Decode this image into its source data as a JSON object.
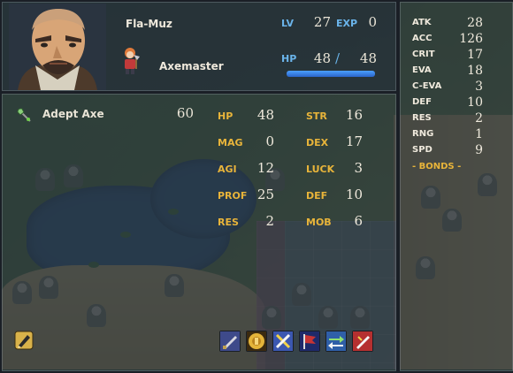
{
  "unit": {
    "name": "Fla-Muz",
    "class": "Axemaster",
    "level_label": "LV",
    "level": "27",
    "exp_label": "EXP",
    "exp": "0",
    "hp_label": "HP",
    "hp_current": "48",
    "hp_separator": "/",
    "hp_max": "48",
    "hp_fill_fraction": 1.0
  },
  "weapon": {
    "icon": "axe-icon",
    "name": "Adept Axe",
    "uses": "60"
  },
  "stats": [
    {
      "label": "HP",
      "value": "48"
    },
    {
      "label": "STR",
      "value": "16"
    },
    {
      "label": "MAG",
      "value": "0"
    },
    {
      "label": "DEX",
      "value": "17"
    },
    {
      "label": "AGI",
      "value": "12"
    },
    {
      "label": "LUCK",
      "value": "3"
    },
    {
      "label": "PROF",
      "value": "25"
    },
    {
      "label": "DEF",
      "value": "10"
    },
    {
      "label": "RES",
      "value": "2"
    },
    {
      "label": "MOB",
      "value": "6"
    }
  ],
  "combat": [
    {
      "label": "ATK",
      "value": "28"
    },
    {
      "label": "ACC",
      "value": "126"
    },
    {
      "label": "CRIT",
      "value": "17"
    },
    {
      "label": "EVA",
      "value": "18"
    },
    {
      "label": "C-EVA",
      "value": "3"
    },
    {
      "label": "DEF",
      "value": "10"
    },
    {
      "label": "RES",
      "value": "2"
    },
    {
      "label": "RNG",
      "value": "1"
    },
    {
      "label": "SPD",
      "value": "9"
    }
  ],
  "bonds_label": "- BONDS -",
  "skills": [
    "pen-skill-icon",
    "crest-skill-icon",
    "crossed-swords-skill-icon",
    "banner-skill-icon",
    "swap-arrows-skill-icon",
    "sword-slash-skill-icon"
  ],
  "colors": {
    "stat_label": "#e8b43a",
    "accent_blue": "#6ab4ea",
    "hp_bar": "#2c64c9"
  }
}
